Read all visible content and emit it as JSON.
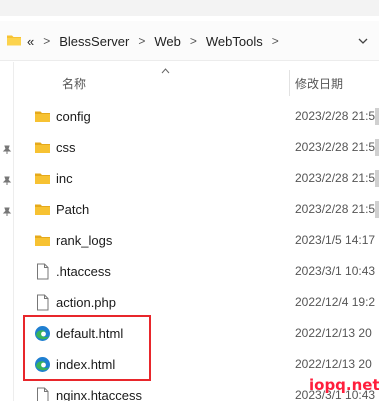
{
  "address": {
    "overflow": "«",
    "crumbs": [
      "BlessServer",
      "Web",
      "WebTools"
    ],
    "separator": ">"
  },
  "columns": {
    "name": "名称",
    "date": "修改日期"
  },
  "files": [
    {
      "name": "config",
      "date": "2023/2/28 21:5",
      "type": "folder"
    },
    {
      "name": "css",
      "date": "2023/2/28 21:5",
      "type": "folder"
    },
    {
      "name": "inc",
      "date": "2023/2/28 21:5",
      "type": "folder"
    },
    {
      "name": "Patch",
      "date": "2023/2/28 21:5",
      "type": "folder"
    },
    {
      "name": "rank_logs",
      "date": "2023/1/5 14:17",
      "type": "folder"
    },
    {
      "name": ".htaccess",
      "date": "2023/3/1 10:43",
      "type": "file"
    },
    {
      "name": "action.php",
      "date": "2022/12/4 19:2",
      "type": "file"
    },
    {
      "name": "default.html",
      "date": "2022/12/13 20",
      "type": "edge"
    },
    {
      "name": "index.html",
      "date": "2022/12/13 20",
      "type": "edge"
    },
    {
      "name": "nginx.htaccess",
      "date": "2023/3/1 10:43",
      "type": "file"
    }
  ],
  "watermark": "iopq.net",
  "colors": {
    "folder": "#f7c232",
    "highlight": "#e8262b",
    "watermark": "#ff1e3c",
    "edge_blue": "#1f7fd1",
    "edge_green": "#38b35a"
  }
}
